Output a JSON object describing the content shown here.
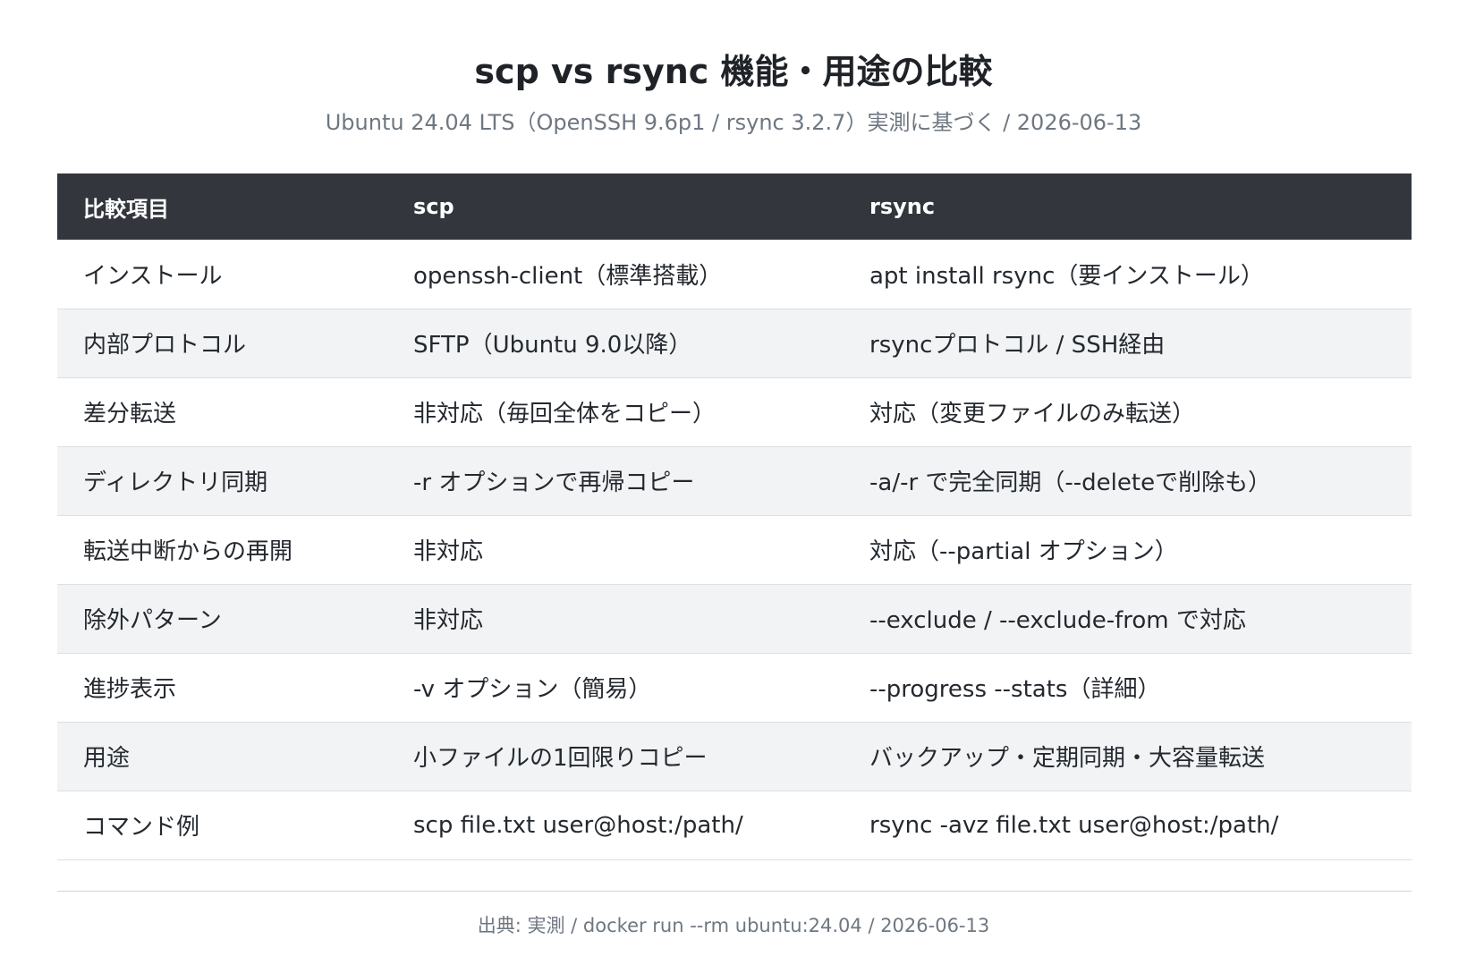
{
  "title": "scp vs rsync 機能・用途の比較",
  "subtitle": "Ubuntu 24.04 LTS（OpenSSH 9.6p1 / rsync 3.2.7）実測に基づく / 2026-06-13",
  "table": {
    "headers": [
      "比較項目",
      "scp",
      "rsync"
    ],
    "rows": [
      [
        "インストール",
        "openssh-client（標準搭載）",
        "apt install rsync（要インストール）"
      ],
      [
        "内部プロトコル",
        "SFTP（Ubuntu 9.0以降）",
        "rsyncプロトコル / SSH経由"
      ],
      [
        "差分転送",
        "非対応（毎回全体をコピー）",
        "対応（変更ファイルのみ転送）"
      ],
      [
        "ディレクトリ同期",
        "-r オプションで再帰コピー",
        "-a/-r で完全同期（--deleteで削除も）"
      ],
      [
        "転送中断からの再開",
        "非対応",
        "対応（--partial オプション）"
      ],
      [
        "除外パターン",
        "非対応",
        "--exclude / --exclude-from で対応"
      ],
      [
        "進捗表示",
        "-v オプション（簡易）",
        "--progress --stats（詳細）"
      ],
      [
        "用途",
        "小ファイルの1回限りコピー",
        "バックアップ・定期同期・大容量転送"
      ],
      [
        "コマンド例",
        "scp file.txt user@host:/path/",
        "rsync -avz file.txt user@host:/path/"
      ]
    ]
  },
  "footer": "出典: 実測 / docker run --rm ubuntu:24.04 / 2026-06-13",
  "colors": {
    "header_bg": "#33373d",
    "alt_row_bg": "#f2f3f5",
    "muted_text": "#6e7781"
  }
}
